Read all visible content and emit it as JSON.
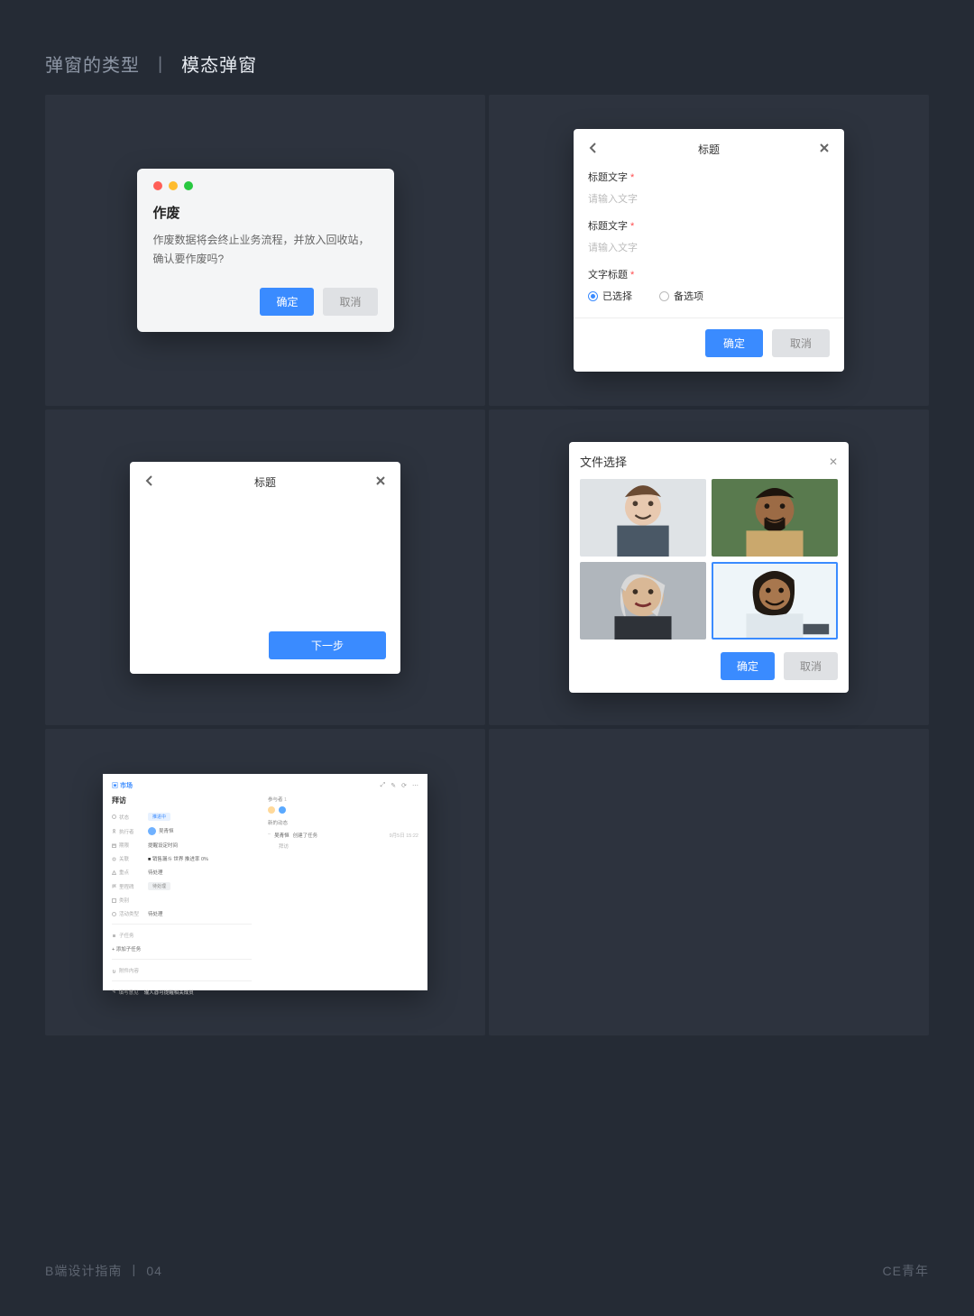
{
  "page": {
    "title_prefix": "弹窗的类型",
    "title_strong": "模态弹窗",
    "footer_left_a": "B端设计指南",
    "footer_left_b": "04",
    "footer_right": "CE青年"
  },
  "card1": {
    "title": "作废",
    "body": "作废数据将会终止业务流程，并放入回收站，确认要作废吗?",
    "ok": "确定",
    "cancel": "取消"
  },
  "card2": {
    "title": "标题",
    "field1_label": "标题文字",
    "field1_placeholder": "请输入文字",
    "field2_label": "标题文字",
    "field2_placeholder": "请输入文字",
    "field3_label": "文字标题",
    "radio_selected": "已选择",
    "radio_other": "备选项",
    "ok": "确定",
    "cancel": "取消"
  },
  "card3": {
    "title": "标题",
    "next": "下一步"
  },
  "card4": {
    "title": "文件选择",
    "ok": "确定",
    "cancel": "取消"
  },
  "card5": {
    "brand": "▣ 市场",
    "heading": "拜访",
    "rows": {
      "status_k": "状态",
      "status_v": "推进中",
      "owner_k": "执行者",
      "owner_v": "吴青恒",
      "date_k": "期限",
      "date_v": "提醒设定时间",
      "relate_k": "关联",
      "relate_v": "销售漏斗   世界   推进率 0%",
      "priority_k": "重点",
      "priority_v": "待处理",
      "milestone_k": "里程碑",
      "milestone_v": "待处理",
      "category_k": "类别",
      "subcat_k": "活动类型",
      "subcat_v": "待处理",
      "child_k": "子任务",
      "add_child": "添加子任务",
      "attach_k": "附件内容",
      "comment_k": "填写意见",
      "comment_ph": "输入@可提醒相关成员"
    },
    "right": {
      "participants": "参与者",
      "recent": "新的动态",
      "item_name": "吴青恒",
      "item_text": "创建了任务",
      "item_sub": "拜访",
      "item_time": "9月5日 15:22"
    }
  }
}
